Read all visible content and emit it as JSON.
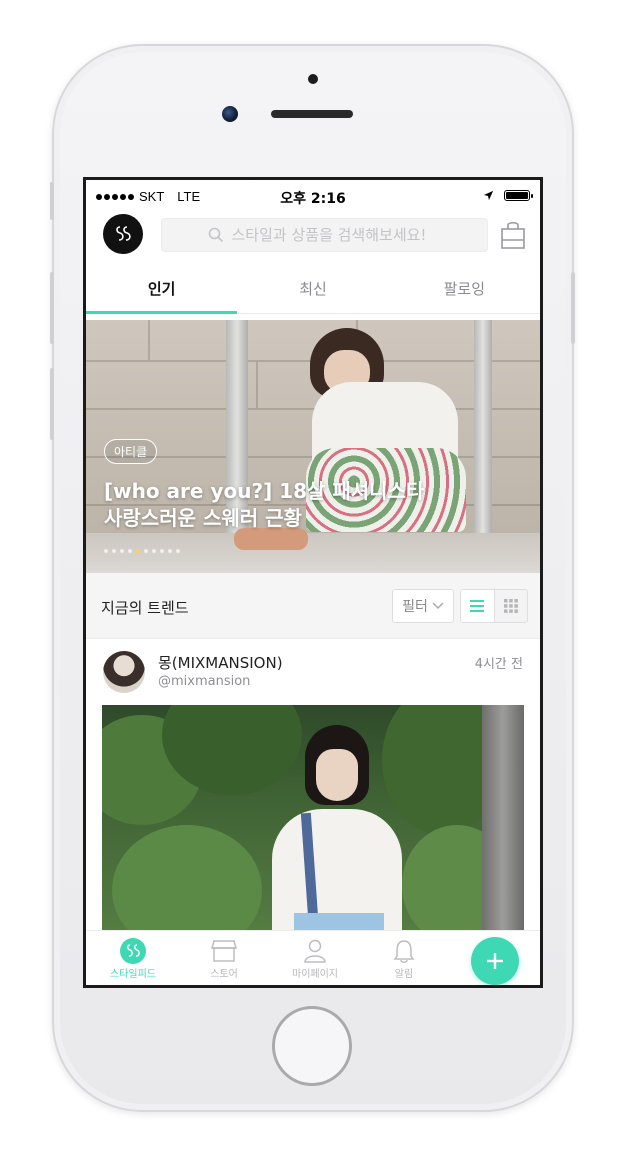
{
  "status_bar": {
    "carrier": "SKT",
    "network": "LTE",
    "time": "오후 2:16",
    "battery_level": 1.0
  },
  "header": {
    "logo_icon": "ss-logo-icon",
    "search_placeholder": "스타일과 상품을 검색해보세요!",
    "bag_icon": "shopping-bag-icon"
  },
  "tabs": [
    {
      "label": "인기",
      "active": true
    },
    {
      "label": "최신",
      "active": false
    },
    {
      "label": "팔로잉",
      "active": false
    }
  ],
  "hero": {
    "badge": "아티클",
    "title_line1": "[who are you?] 18살 패셔니스타",
    "title_line2": "사랑스러운 스웨러 근황",
    "pager_count": 10,
    "pager_active_index": 4
  },
  "trend": {
    "title": "지금의 트렌드",
    "filter_label": "필터",
    "view_mode": "list"
  },
  "post": {
    "username": "몽(MIXMANSION)",
    "handle": "@mixmansion",
    "time_ago": "4시간 전"
  },
  "bottom_nav": [
    {
      "label": "스타일피드",
      "icon": "style-feed-icon",
      "active": true
    },
    {
      "label": "스토어",
      "icon": "store-icon",
      "active": false
    },
    {
      "label": "마이페이지",
      "icon": "person-icon",
      "active": false
    },
    {
      "label": "알림",
      "icon": "bell-icon",
      "active": false
    }
  ],
  "colors": {
    "accent": "#3fd8b4",
    "pager_active": "#ffd54a"
  }
}
